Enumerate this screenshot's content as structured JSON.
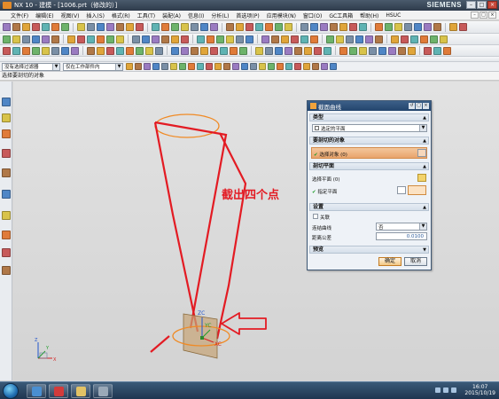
{
  "window": {
    "title": "NX 10 - 建模 - [1006.prt（修改的）]",
    "brand": "SIEMENS",
    "controls": [
      "–",
      "□",
      "×"
    ]
  },
  "menubar": {
    "items": [
      "文件(F)",
      "编辑(E)",
      "视图(V)",
      "插入(S)",
      "格式(R)",
      "工具(T)",
      "装配(A)",
      "信息(I)",
      "分析(L)",
      "首选项(P)",
      "应用模块(N)",
      "窗口(O)",
      "GC工具箱",
      "帮助(H)",
      "HSUC"
    ]
  },
  "selection": {
    "filter": "没有选择过滤器",
    "scope": "仅在工作部件内"
  },
  "cue": {
    "text": "选择要剖切的对象"
  },
  "annotation": {
    "text": "截出四个点"
  },
  "viewport": {
    "triad_labels": [
      "ZC",
      "YC",
      "XC"
    ],
    "corner_triad_labels": [
      "Z",
      "Y",
      "X"
    ]
  },
  "dialog": {
    "title": "截面曲线",
    "sections": {
      "type": {
        "label": "类型",
        "value": "选定的平面"
      },
      "objects": {
        "label": "要剖切的对象",
        "select_label": "选择对象 (0)"
      },
      "plane": {
        "label": "剖切平面",
        "select_label": "选择平面 (0)",
        "specify_label": "指定平面"
      },
      "settings": {
        "label": "设置",
        "associative_label": "关联",
        "associative_checked": false,
        "join_label": "连结曲线",
        "join_value": "否",
        "tolerance_label": "距离公差",
        "tolerance_value": "0.0100"
      },
      "preview": {
        "label": "预览"
      }
    },
    "ok_label": "确定",
    "cancel_label": "取消"
  },
  "taskbar": {
    "time": "16:07",
    "date": "2015/10/19"
  },
  "colors": {
    "red_annotation": "#e31b23",
    "orange_curve": "#f08a24",
    "dialog_highlight": "#e9a46c"
  }
}
